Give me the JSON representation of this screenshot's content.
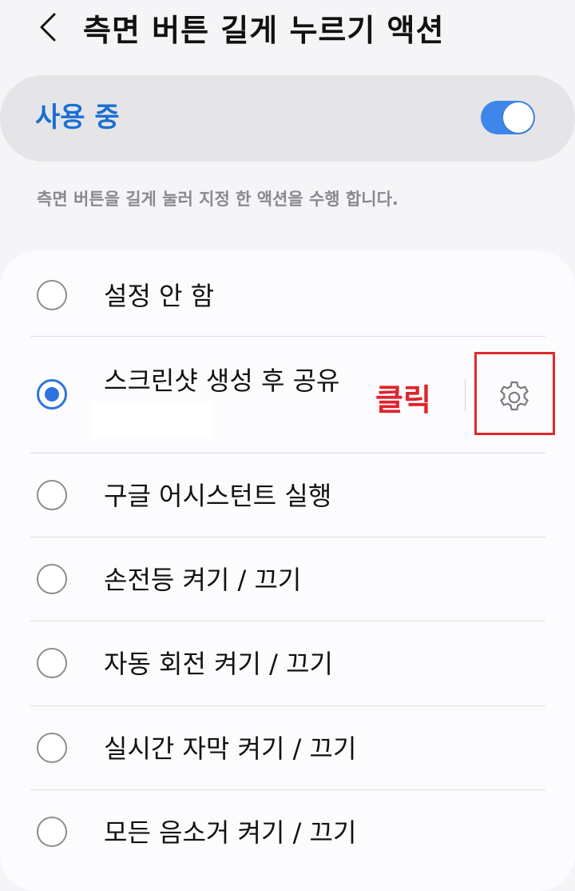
{
  "header": {
    "title": "측면 버튼 길게 누르기 액션",
    "back_icon": "chevron-left-icon"
  },
  "master_switch": {
    "label": "사용 중",
    "on": true,
    "accent_color": "#3e86ea"
  },
  "description": "측면 버튼을 길게 눌러 지정 한 액션을 수행 합니다.",
  "options": [
    {
      "label": "설정 안 함",
      "selected": false
    },
    {
      "label": "스크린샷 생성 후 공유",
      "selected": true,
      "has_settings": true,
      "settings_icon": "gear-icon"
    },
    {
      "label": "구글 어시스턴트 실행",
      "selected": false
    },
    {
      "label": "손전등 켜기 / 끄기",
      "selected": false
    },
    {
      "label": "자동 회전 켜기 / 끄기",
      "selected": false
    },
    {
      "label": "실시간 자막 켜기 / 끄기",
      "selected": false
    },
    {
      "label": "모든 음소거 켜기 / 끄기",
      "selected": false
    }
  ],
  "annotation": {
    "text": "클릭",
    "color": "#e0232b"
  }
}
